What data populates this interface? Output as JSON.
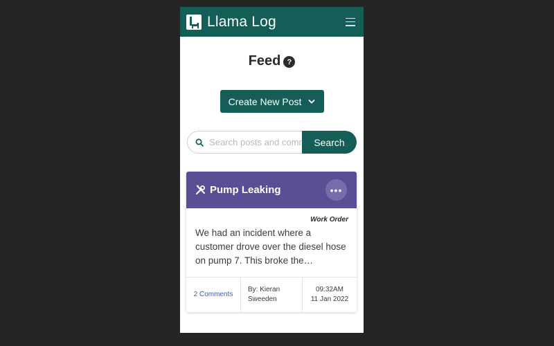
{
  "app": {
    "title": "Llama Log"
  },
  "feed": {
    "title": "Feed",
    "help_glyph": "?"
  },
  "create_post": {
    "label": "Create New Post"
  },
  "search": {
    "placeholder": "Search posts and comments",
    "button_label": "Search"
  },
  "post": {
    "title": "Pump Leaking",
    "type": "Work Order",
    "excerpt": "We had an incident where a customer drove over the diesel hose on pump 7. This broke the…",
    "more_glyph": "•••",
    "comments": "2 Comments",
    "author_line1": "By: Kieran",
    "author_line2": "Sweeden",
    "time": "09:32AM",
    "date": "11 Jan 2022",
    "header_color": "#5a4f94"
  },
  "colors": {
    "brand": "#155e58",
    "background": "#252525",
    "link": "#3d5bb5"
  },
  "icons": {
    "logo": "llama-icon",
    "menu": "hamburger-icon",
    "help": "question-circle-icon",
    "dropdown": "chevron-down-icon",
    "search": "search-icon",
    "post_type": "tools-icon",
    "more": "ellipsis-icon"
  }
}
